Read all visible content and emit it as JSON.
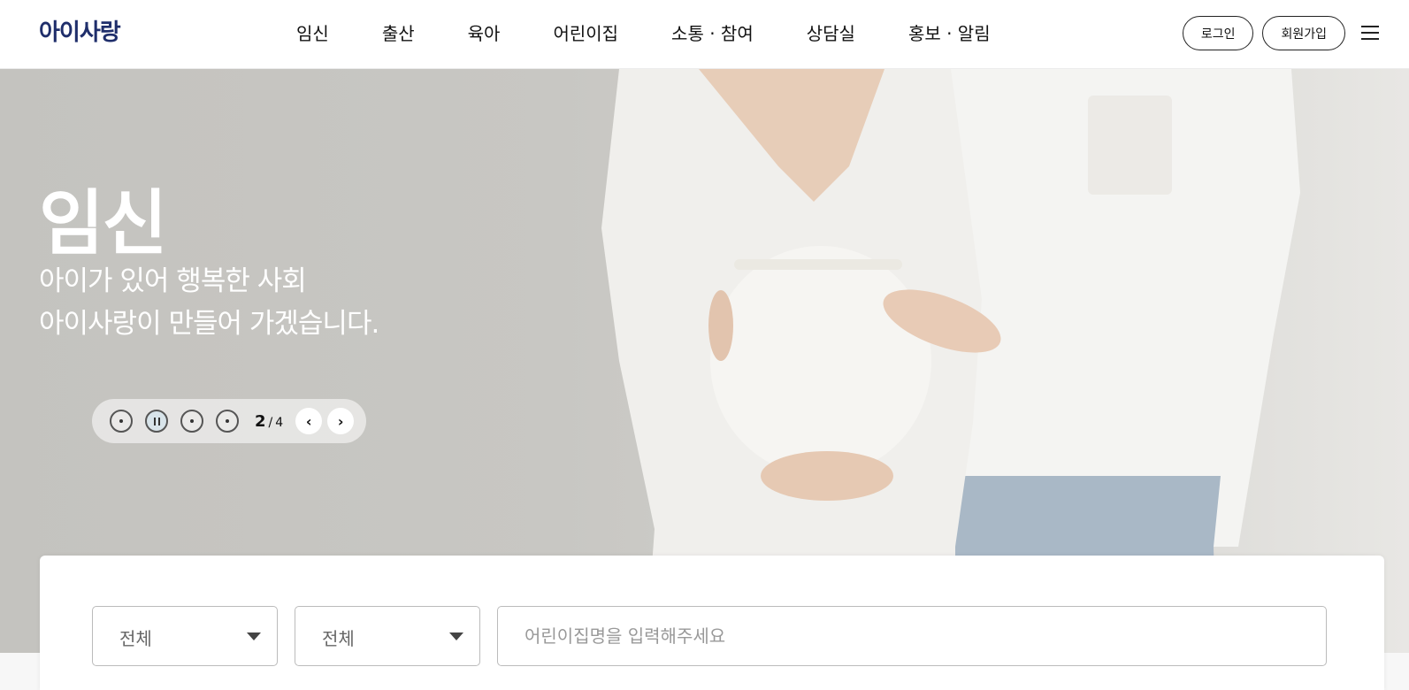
{
  "header": {
    "logo": "아이사랑",
    "nav": [
      "임신",
      "출산",
      "육아",
      "어린이집",
      "소통 · 참여",
      "상담실",
      "홍보 · 알림"
    ],
    "login_label": "로그인",
    "signup_label": "회원가입",
    "menu_icon": "hamburger-menu-icon"
  },
  "hero": {
    "title": "임신",
    "subtitle_line1": "아이가 있어 행복한 사회",
    "subtitle_line2": "아이사랑이 만들어 가겠습니다.",
    "slider": {
      "current": "2",
      "separator": "/",
      "total": "4",
      "prev_icon": "chevron-left-icon",
      "next_icon": "chevron-right-icon"
    }
  },
  "search": {
    "select1_value": "전체",
    "select2_value": "전체",
    "input_placeholder": "어린이집명을 입력해주세요"
  },
  "colors": {
    "brand": "#1f2e6b",
    "hero_bg": "#c7c6c2"
  }
}
